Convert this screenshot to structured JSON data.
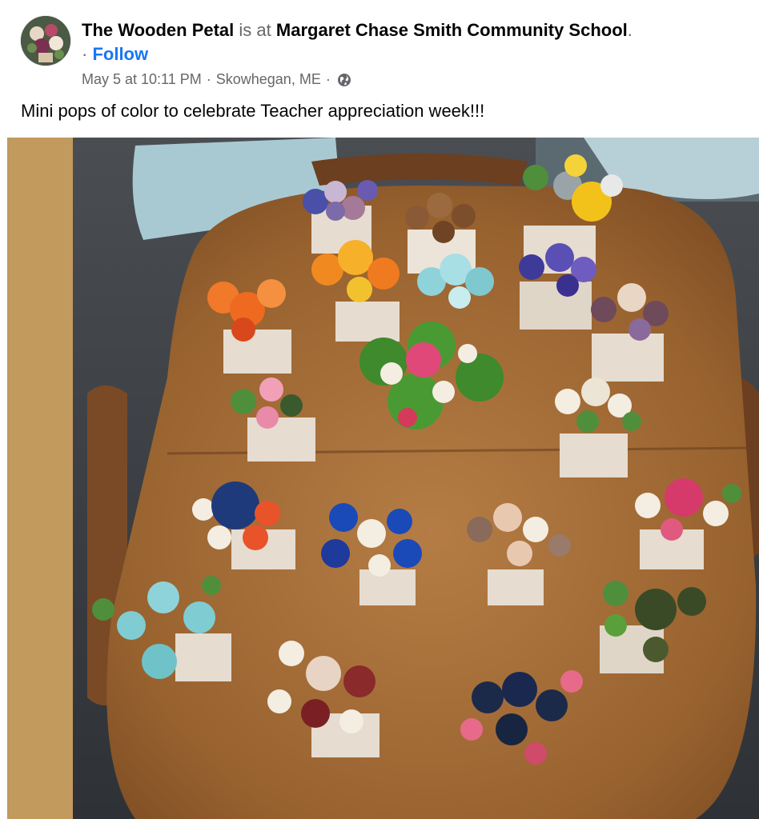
{
  "post": {
    "author": "The Wooden Petal",
    "is_at": "is at",
    "location_name": "Margaret Chase Smith Community School",
    "period": ".",
    "follow_prefix": "·",
    "follow_label": "Follow",
    "date": "May 5 at 10:11 PM",
    "separator": "·",
    "place": "Skowhegan, ME",
    "separator2": "·",
    "audience_icon": "globe-icon",
    "caption": "Mini pops of color to celebrate Teacher appreciation week!!!"
  },
  "colors": {
    "link_blue": "#1877f2",
    "meta_gray": "#65676b",
    "photo_border": "#c29a5e"
  }
}
